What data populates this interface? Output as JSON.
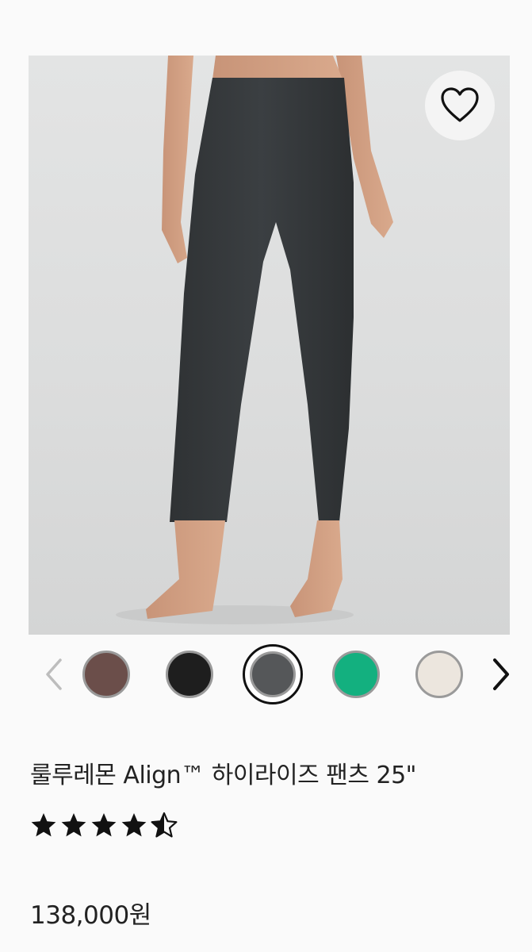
{
  "product": {
    "title": "룰루레몬 Align™ 하이라이즈 팬츠 25\"",
    "price": "138,000원",
    "rating": 4.5,
    "rating_max": 5
  },
  "icons": {
    "favorite": "heart-outline-icon",
    "prev": "chevron-left-icon",
    "next": "chevron-right-icon",
    "star": "star-icon"
  },
  "swatches": [
    {
      "color": "#6b4e4a",
      "selected": false
    },
    {
      "color": "#1e1e1e",
      "selected": false
    },
    {
      "color": "#555759",
      "selected": true
    },
    {
      "color": "#13b07f",
      "selected": false
    },
    {
      "color": "#ece6de",
      "selected": false
    }
  ]
}
